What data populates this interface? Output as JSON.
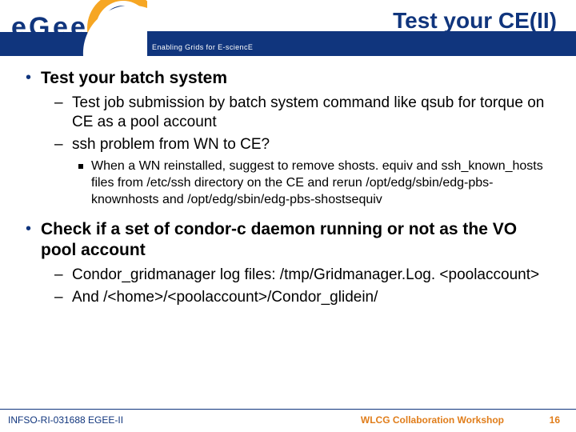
{
  "header": {
    "title": "Test your CE(II)",
    "tagline": "Enabling Grids for E-sciencE",
    "logo_text": "eGee"
  },
  "body": {
    "item1": {
      "text": "Test your batch system",
      "sub1": "Test job submission by batch system command like qsub for torque on CE as a pool account",
      "sub2": "ssh problem from WN to CE?",
      "sub2_detail": "When a WN reinstalled, suggest to remove shosts. equiv and ssh_known_hosts files from /etc/ssh directory on the CE  and rerun /opt/edg/sbin/edg-pbs-knownhosts and /opt/edg/sbin/edg-pbs-shostsequiv"
    },
    "item2": {
      "text": "Check if a set of condor-c daemon running or not as the VO pool account",
      "sub1": "Condor_gridmanager log files: /tmp/Gridmanager.Log. <poolaccount>",
      "sub2": "And /<home>/<poolaccount>/Condor_glidein/"
    }
  },
  "footer": {
    "left": "INFSO-RI-031688 EGEE-II",
    "center": "WLCG Collaboration Workshop",
    "pagenum": "16"
  }
}
